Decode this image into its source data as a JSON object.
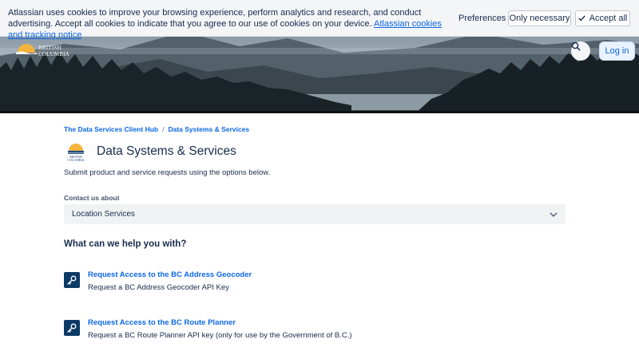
{
  "cookie_banner": {
    "text": "Atlassian uses cookies to improve your browsing experience, perform analytics and research, and conduct advertising. Accept all cookies to indicate that you agree to our use of cookies on your device.",
    "link_text": "Atlassian cookies and tracking notice",
    "preferences_label": "Preferences",
    "only_necessary_label": "Only necessary",
    "accept_all_label": "Accept all"
  },
  "header": {
    "logo_line1": "BRITISH",
    "logo_line2": "COLUMBIA",
    "login_label": "Log in"
  },
  "breadcrumb": [
    {
      "label": "The Data Services Client Hub"
    },
    {
      "label": "Data Systems & Services"
    }
  ],
  "breadcrumb_separator": "/",
  "page": {
    "title": "Data Systems & Services",
    "subtitle": "Submit product and service requests using the options below.",
    "title_logo_line1": "BRITISH",
    "title_logo_line2": "COLUMBIA"
  },
  "contact": {
    "label": "Contact us about",
    "selected": "Location Services"
  },
  "help_heading": "What can we help you with?",
  "requests": [
    {
      "title": "Request Access to the BC Address Geocoder",
      "description": "Request a BC Address Geocoder API Key",
      "icon": "key-icon"
    },
    {
      "title": "Request Access to the BC Route Planner",
      "description": "Request a BC Route Planner API key (only for use by the Government of B.C.)",
      "icon": "key-icon"
    }
  ],
  "colors": {
    "link": "#0c66e4",
    "text": "#172b4d",
    "icon_bg": "#0c3a66",
    "bc_gold": "#f3b33d",
    "bc_blue": "#1f4a84"
  }
}
